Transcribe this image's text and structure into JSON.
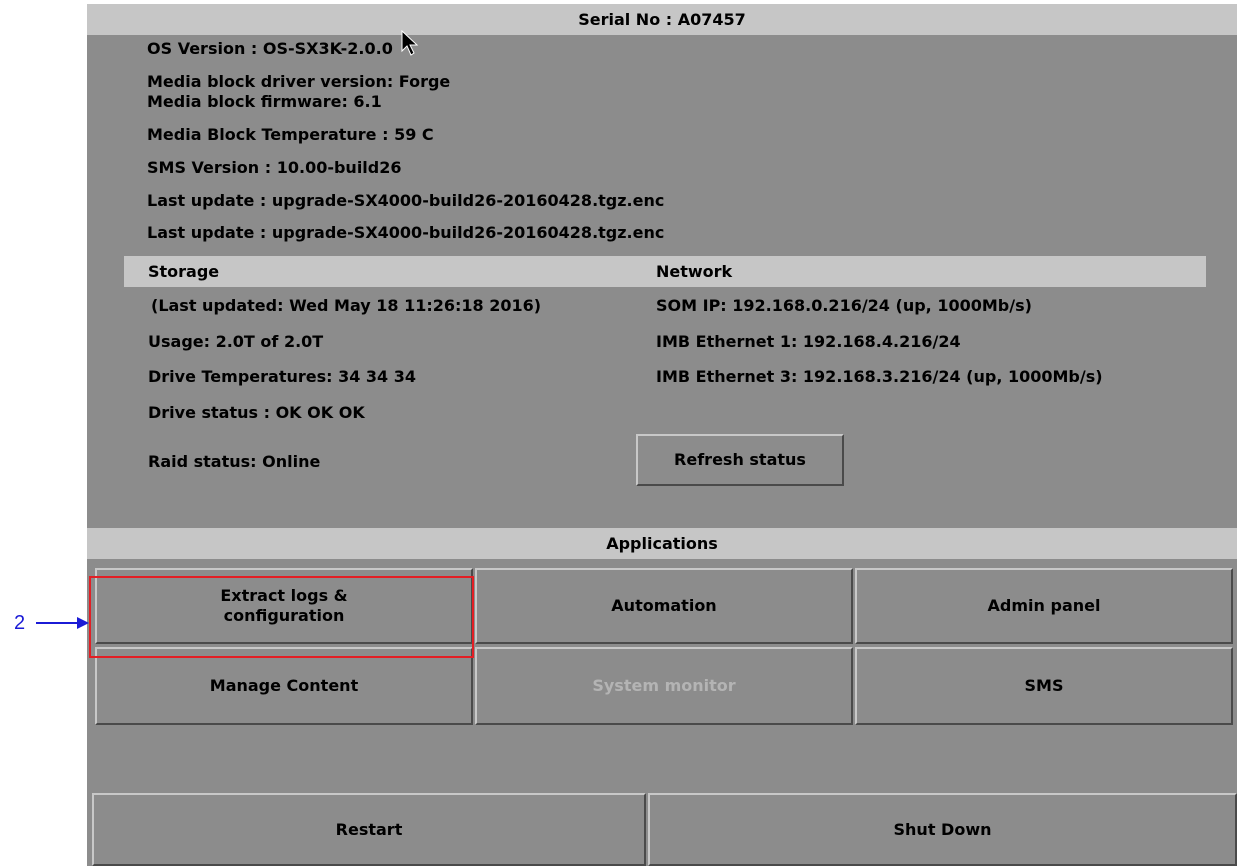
{
  "header": {
    "serial": "Serial No : A07457"
  },
  "info": {
    "os_version": "OS Version : OS-SX3K-2.0.0",
    "driver_version": "Media block driver version: Forge",
    "firmware": "Media block firmware: 6.1",
    "temperature": "Media Block Temperature : 59 C",
    "sms_version": "SMS Version : 10.00-build26",
    "last_update": "Last update : upgrade-SX4000-build26-20160428.tgz.enc"
  },
  "storage": {
    "title": "Storage",
    "last_updated": "(Last updated: Wed May 18 11:26:18 2016)",
    "usage": "Usage: 2.0T of 2.0T",
    "drive_temps": "Drive Temperatures: 34 34 34",
    "drive_status": "Drive status : OK OK OK",
    "raid_status": "Raid status: Online"
  },
  "network": {
    "title": "Network",
    "som_ip": "SOM IP: 192.168.0.216/24 (up, 1000Mb/s)",
    "imb_eth1": "IMB Ethernet 1: 192.168.4.216/24",
    "imb_eth3": "IMB Ethernet 3: 192.168.3.216/24 (up, 1000Mb/s)",
    "refresh_label": "Refresh status"
  },
  "applications": {
    "title": "Applications",
    "extract_line1": "Extract logs &",
    "extract_line2": "configuration",
    "automation": "Automation",
    "admin_panel": "Admin panel",
    "manage_content": "Manage Content",
    "system_monitor": "System monitor",
    "sms": "SMS"
  },
  "power": {
    "restart": "Restart",
    "shutdown": "Shut Down"
  },
  "annotation": {
    "number": "2",
    "color": "#1b1bd6",
    "highlight_color": "#e31e24"
  }
}
